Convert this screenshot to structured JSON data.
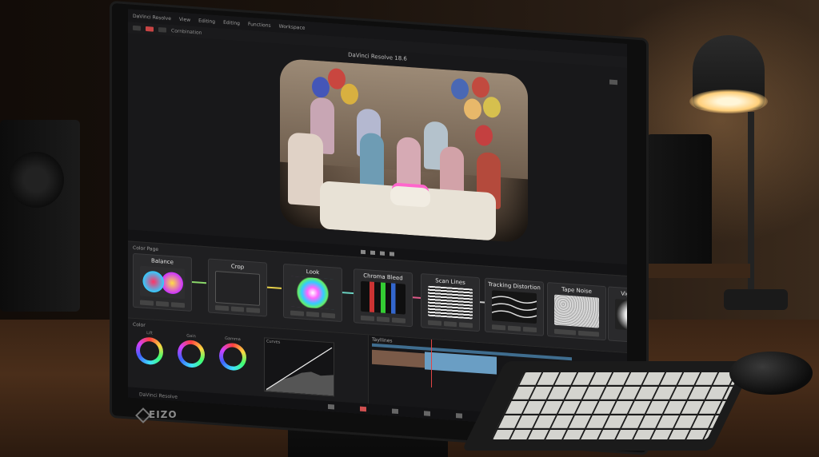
{
  "app": {
    "title": "DaVinci Resolve 18.6",
    "menu": [
      "DaVinci Resolve",
      "Resolve",
      "View",
      "Editing",
      "Editing",
      "Functions",
      "Workspace"
    ],
    "toolbar_label": "Cornbination"
  },
  "viewer": {
    "title": "DaVinci Resolve 18.6",
    "photo_subject": "kids-birthday-party-photo"
  },
  "node_editor": {
    "section_label": "Color Page",
    "nodes": [
      {
        "title": "Balance"
      },
      {
        "title": "Crop"
      },
      {
        "title": "Look"
      },
      {
        "title": "Chroma Bleed"
      },
      {
        "title": "Scan Lines"
      },
      {
        "title": "Tracking Distortion"
      },
      {
        "title": "Tape Noise"
      },
      {
        "title": "Vignette"
      }
    ]
  },
  "color_panel": {
    "section_label": "Color",
    "wheels": [
      {
        "label": "Lift"
      },
      {
        "label": "Gain"
      },
      {
        "label": "Gamma"
      }
    ],
    "curves_title": "Curves"
  },
  "timeline": {
    "title": "Tayllines",
    "page_name": "DaVinci Resolve"
  },
  "device": {
    "brand": "EIZO"
  },
  "colors": {
    "accent_red": "#c84444",
    "clip_blue": "#6a9ec4",
    "link_green": "#8bd86a"
  }
}
